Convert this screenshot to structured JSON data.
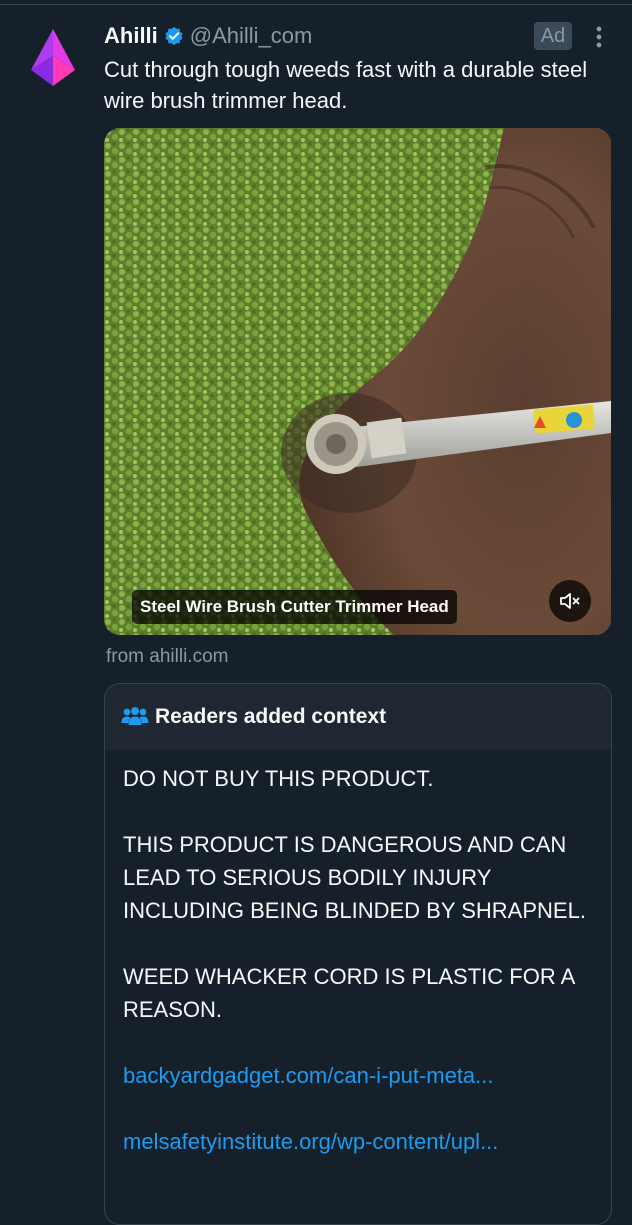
{
  "post": {
    "author_name": "Ahilli",
    "author_handle": "@Ahilli_com",
    "ad_label": "Ad",
    "text": "Cut through tough weeds fast with a durable steel wire brush trimmer head.",
    "media_caption": "Steel Wire Brush Cutter Trimmer Head",
    "source": "from ahilli.com"
  },
  "context_note": {
    "title": "Readers added context",
    "paragraphs": [
      "DO NOT BUY THIS PRODUCT.",
      "THIS PRODUCT IS DANGEROUS AND CAN LEAD TO SERIOUS BODILY INJURY INCLUDING BEING BLINDED BY SHRAPNEL.",
      "WEED WHACKER CORD IS PLASTIC FOR A REASON."
    ],
    "links": [
      "backyardgadget.com/can-i-put-meta...",
      "melsafetyinstitute.org/wp-content/upl..."
    ]
  },
  "icons": {
    "avatar": "ahilli-logo",
    "verified": "verified-badge-icon",
    "more": "more-options-icon",
    "mute": "muted-speaker-icon",
    "context": "people-icon"
  },
  "colors": {
    "background": "#15202b",
    "link": "#1d9bf0",
    "verified": "#1d9bf0",
    "secondary_text": "#8b98a5"
  }
}
